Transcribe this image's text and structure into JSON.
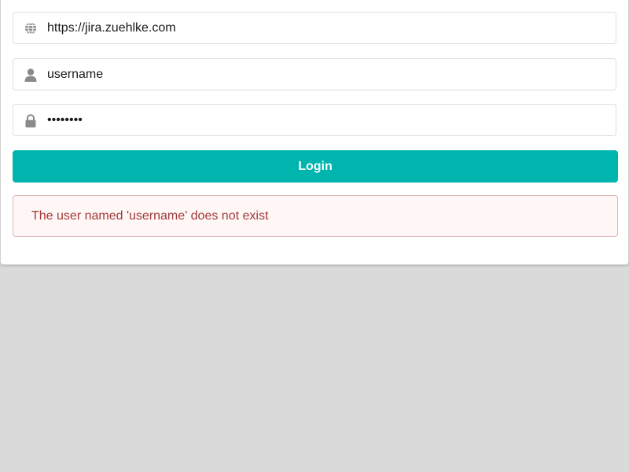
{
  "form": {
    "url_value": "https://jira.zuehlke.com",
    "username_value": "username",
    "password_value": "password",
    "login_label": "Login"
  },
  "icons": {
    "url": "globe-icon",
    "username": "user-icon",
    "password": "lock-icon"
  },
  "error": {
    "message": "The user named 'username' does not exist"
  },
  "colors": {
    "accent": "#00b5ad",
    "error_text": "#9f3a38",
    "error_bg": "#fff6f6",
    "error_border": "#e0b4b4",
    "page_bg": "#dadada"
  }
}
